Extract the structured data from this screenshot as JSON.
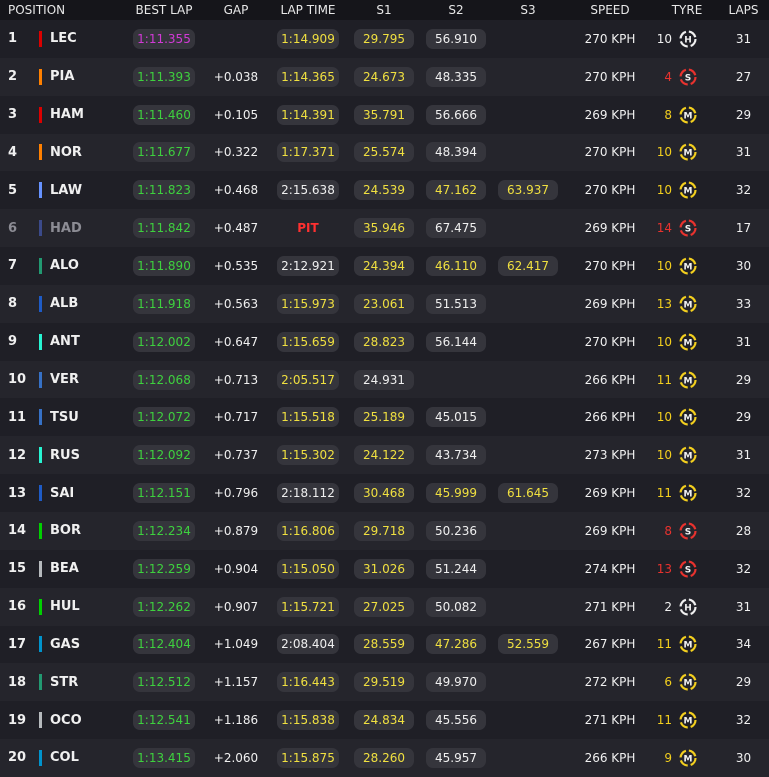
{
  "header": {
    "position": "POSITION",
    "best_lap": "BEST LAP",
    "gap": "GAP",
    "lap_time": "LAP TIME",
    "s1": "S1",
    "s2": "S2",
    "s3": "S3",
    "speed": "SPEED",
    "tyre": "TYRE",
    "laps": "LAPS"
  },
  "colors": {
    "green": "#3ed13e",
    "purple": "#d23ad6",
    "yellow": "#f0e040",
    "red": "#ff3030",
    "soft": "#e8322e",
    "medium": "#f3cf1e",
    "hard": "#f0f0f0"
  },
  "rows": [
    {
      "pos": "1",
      "team": "#dc0000",
      "name": "LEC",
      "best": "1:11.355",
      "best_c": "purple",
      "gap": "",
      "lap": "1:14.909",
      "lap_c": "yellow",
      "s1": "29.795",
      "s1_c": "yellow",
      "s2": "56.910",
      "s2_c": "white",
      "s3": "",
      "s3_c": "none",
      "speed": "270 KPH",
      "tyre_age": "10",
      "tyre_age_c": "#f0f0f0",
      "tyre": "H",
      "laps": "31"
    },
    {
      "pos": "2",
      "team": "#ff8000",
      "name": "PIA",
      "best": "1:11.393",
      "best_c": "green",
      "gap": "+0.038",
      "lap": "1:14.365",
      "lap_c": "yellow",
      "s1": "24.673",
      "s1_c": "yellow",
      "s2": "48.335",
      "s2_c": "white",
      "s3": "",
      "s3_c": "none",
      "speed": "270 KPH",
      "tyre_age": "4",
      "tyre_age_c": "#e8322e",
      "tyre": "S",
      "laps": "27"
    },
    {
      "pos": "3",
      "team": "#dc0000",
      "name": "HAM",
      "best": "1:11.460",
      "best_c": "green",
      "gap": "+0.105",
      "lap": "1:14.391",
      "lap_c": "yellow",
      "s1": "35.791",
      "s1_c": "yellow",
      "s2": "56.666",
      "s2_c": "white",
      "s3": "",
      "s3_c": "none",
      "speed": "269 KPH",
      "tyre_age": "8",
      "tyre_age_c": "#f3cf1e",
      "tyre": "M",
      "laps": "29"
    },
    {
      "pos": "4",
      "team": "#ff8000",
      "name": "NOR",
      "best": "1:11.677",
      "best_c": "green",
      "gap": "+0.322",
      "lap": "1:17.371",
      "lap_c": "yellow",
      "s1": "25.574",
      "s1_c": "yellow",
      "s2": "48.394",
      "s2_c": "white",
      "s3": "",
      "s3_c": "none",
      "speed": "270 KPH",
      "tyre_age": "10",
      "tyre_age_c": "#f3cf1e",
      "tyre": "M",
      "laps": "31"
    },
    {
      "pos": "5",
      "team": "#6692ff",
      "name": "LAW",
      "best": "1:11.823",
      "best_c": "green",
      "gap": "+0.468",
      "lap": "2:15.638",
      "lap_c": "white",
      "s1": "24.539",
      "s1_c": "yellow",
      "s2": "47.162",
      "s2_c": "yellow",
      "s3": "63.937",
      "s3_c": "yellow",
      "speed": "270 KPH",
      "tyre_age": "10",
      "tyre_age_c": "#f3cf1e",
      "tyre": "M",
      "laps": "32"
    },
    {
      "pos": "6",
      "team": "#3b4a8a",
      "name": "HAD",
      "best": "1:11.842",
      "best_c": "green",
      "gap": "+0.487",
      "lap": "PIT",
      "lap_c": "pit",
      "s1": "35.946",
      "s1_c": "yellow",
      "s2": "67.475",
      "s2_c": "white",
      "s3": "",
      "s3_c": "none",
      "speed": "269 KPH",
      "tyre_age": "14",
      "tyre_age_c": "#e8322e",
      "tyre": "S",
      "laps": "17",
      "dim": true
    },
    {
      "pos": "7",
      "team": "#229971",
      "name": "ALO",
      "best": "1:11.890",
      "best_c": "green",
      "gap": "+0.535",
      "lap": "2:12.921",
      "lap_c": "white",
      "s1": "24.394",
      "s1_c": "yellow",
      "s2": "46.110",
      "s2_c": "yellow",
      "s3": "62.417",
      "s3_c": "yellow",
      "speed": "270 KPH",
      "tyre_age": "10",
      "tyre_age_c": "#f3cf1e",
      "tyre": "M",
      "laps": "30"
    },
    {
      "pos": "8",
      "team": "#1e5bc6",
      "name": "ALB",
      "best": "1:11.918",
      "best_c": "green",
      "gap": "+0.563",
      "lap": "1:15.973",
      "lap_c": "yellow",
      "s1": "23.061",
      "s1_c": "yellow",
      "s2": "51.513",
      "s2_c": "white",
      "s3": "",
      "s3_c": "none",
      "speed": "269 KPH",
      "tyre_age": "13",
      "tyre_age_c": "#f3cf1e",
      "tyre": "M",
      "laps": "33"
    },
    {
      "pos": "9",
      "team": "#27f4d2",
      "name": "ANT",
      "best": "1:12.002",
      "best_c": "green",
      "gap": "+0.647",
      "lap": "1:15.659",
      "lap_c": "yellow",
      "s1": "28.823",
      "s1_c": "yellow",
      "s2": "56.144",
      "s2_c": "white",
      "s3": "",
      "s3_c": "none",
      "speed": "270 KPH",
      "tyre_age": "10",
      "tyre_age_c": "#f3cf1e",
      "tyre": "M",
      "laps": "31"
    },
    {
      "pos": "10",
      "team": "#3671c6",
      "name": "VER",
      "best": "1:12.068",
      "best_c": "green",
      "gap": "+0.713",
      "lap": "2:05.517",
      "lap_c": "yellow",
      "s1": "24.931",
      "s1_c": "white",
      "s2": "",
      "s2_c": "none",
      "s3": "",
      "s3_c": "none",
      "speed": "266 KPH",
      "tyre_age": "11",
      "tyre_age_c": "#f3cf1e",
      "tyre": "M",
      "laps": "29"
    },
    {
      "pos": "11",
      "team": "#3671c6",
      "name": "TSU",
      "best": "1:12.072",
      "best_c": "green",
      "gap": "+0.717",
      "lap": "1:15.518",
      "lap_c": "yellow",
      "s1": "25.189",
      "s1_c": "yellow",
      "s2": "45.015",
      "s2_c": "white",
      "s3": "",
      "s3_c": "none",
      "speed": "266 KPH",
      "tyre_age": "10",
      "tyre_age_c": "#f3cf1e",
      "tyre": "M",
      "laps": "29"
    },
    {
      "pos": "12",
      "team": "#27f4d2",
      "name": "RUS",
      "best": "1:12.092",
      "best_c": "green",
      "gap": "+0.737",
      "lap": "1:15.302",
      "lap_c": "yellow",
      "s1": "24.122",
      "s1_c": "yellow",
      "s2": "43.734",
      "s2_c": "white",
      "s3": "",
      "s3_c": "none",
      "speed": "273 KPH",
      "tyre_age": "10",
      "tyre_age_c": "#f3cf1e",
      "tyre": "M",
      "laps": "31"
    },
    {
      "pos": "13",
      "team": "#1e5bc6",
      "name": "SAI",
      "best": "1:12.151",
      "best_c": "green",
      "gap": "+0.796",
      "lap": "2:18.112",
      "lap_c": "white",
      "s1": "30.468",
      "s1_c": "yellow",
      "s2": "45.999",
      "s2_c": "yellow",
      "s3": "61.645",
      "s3_c": "yellow",
      "speed": "269 KPH",
      "tyre_age": "11",
      "tyre_age_c": "#f3cf1e",
      "tyre": "M",
      "laps": "32"
    },
    {
      "pos": "14",
      "team": "#00d000",
      "name": "BOR",
      "best": "1:12.234",
      "best_c": "green",
      "gap": "+0.879",
      "lap": "1:16.806",
      "lap_c": "yellow",
      "s1": "29.718",
      "s1_c": "yellow",
      "s2": "50.236",
      "s2_c": "white",
      "s3": "",
      "s3_c": "none",
      "speed": "269 KPH",
      "tyre_age": "8",
      "tyre_age_c": "#e8322e",
      "tyre": "S",
      "laps": "28"
    },
    {
      "pos": "15",
      "team": "#b6babd",
      "name": "BEA",
      "best": "1:12.259",
      "best_c": "green",
      "gap": "+0.904",
      "lap": "1:15.050",
      "lap_c": "yellow",
      "s1": "31.026",
      "s1_c": "yellow",
      "s2": "51.244",
      "s2_c": "white",
      "s3": "",
      "s3_c": "none",
      "speed": "274 KPH",
      "tyre_age": "13",
      "tyre_age_c": "#e8322e",
      "tyre": "S",
      "laps": "32"
    },
    {
      "pos": "16",
      "team": "#00d000",
      "name": "HUL",
      "best": "1:12.262",
      "best_c": "green",
      "gap": "+0.907",
      "lap": "1:15.721",
      "lap_c": "yellow",
      "s1": "27.025",
      "s1_c": "yellow",
      "s2": "50.082",
      "s2_c": "white",
      "s3": "",
      "s3_c": "none",
      "speed": "271 KPH",
      "tyre_age": "2",
      "tyre_age_c": "#f0f0f0",
      "tyre": "H",
      "laps": "31"
    },
    {
      "pos": "17",
      "team": "#0093cc",
      "name": "GAS",
      "best": "1:12.404",
      "best_c": "green",
      "gap": "+1.049",
      "lap": "2:08.404",
      "lap_c": "white",
      "s1": "28.559",
      "s1_c": "yellow",
      "s2": "47.286",
      "s2_c": "yellow",
      "s3": "52.559",
      "s3_c": "yellow",
      "speed": "267 KPH",
      "tyre_age": "11",
      "tyre_age_c": "#f3cf1e",
      "tyre": "M",
      "laps": "34"
    },
    {
      "pos": "18",
      "team": "#229971",
      "name": "STR",
      "best": "1:12.512",
      "best_c": "green",
      "gap": "+1.157",
      "lap": "1:16.443",
      "lap_c": "yellow",
      "s1": "29.519",
      "s1_c": "yellow",
      "s2": "49.970",
      "s2_c": "white",
      "s3": "",
      "s3_c": "none",
      "speed": "272 KPH",
      "tyre_age": "6",
      "tyre_age_c": "#f3cf1e",
      "tyre": "M",
      "laps": "29"
    },
    {
      "pos": "19",
      "team": "#b6babd",
      "name": "OCO",
      "best": "1:12.541",
      "best_c": "green",
      "gap": "+1.186",
      "lap": "1:15.838",
      "lap_c": "yellow",
      "s1": "24.834",
      "s1_c": "yellow",
      "s2": "45.556",
      "s2_c": "white",
      "s3": "",
      "s3_c": "none",
      "speed": "271 KPH",
      "tyre_age": "11",
      "tyre_age_c": "#f3cf1e",
      "tyre": "M",
      "laps": "32"
    },
    {
      "pos": "20",
      "team": "#0093cc",
      "name": "COL",
      "best": "1:13.415",
      "best_c": "green",
      "gap": "+2.060",
      "lap": "1:15.875",
      "lap_c": "yellow",
      "s1": "28.260",
      "s1_c": "yellow",
      "s2": "45.957",
      "s2_c": "white",
      "s3": "",
      "s3_c": "none",
      "speed": "266 KPH",
      "tyre_age": "9",
      "tyre_age_c": "#f3cf1e",
      "tyre": "M",
      "laps": "30"
    }
  ]
}
